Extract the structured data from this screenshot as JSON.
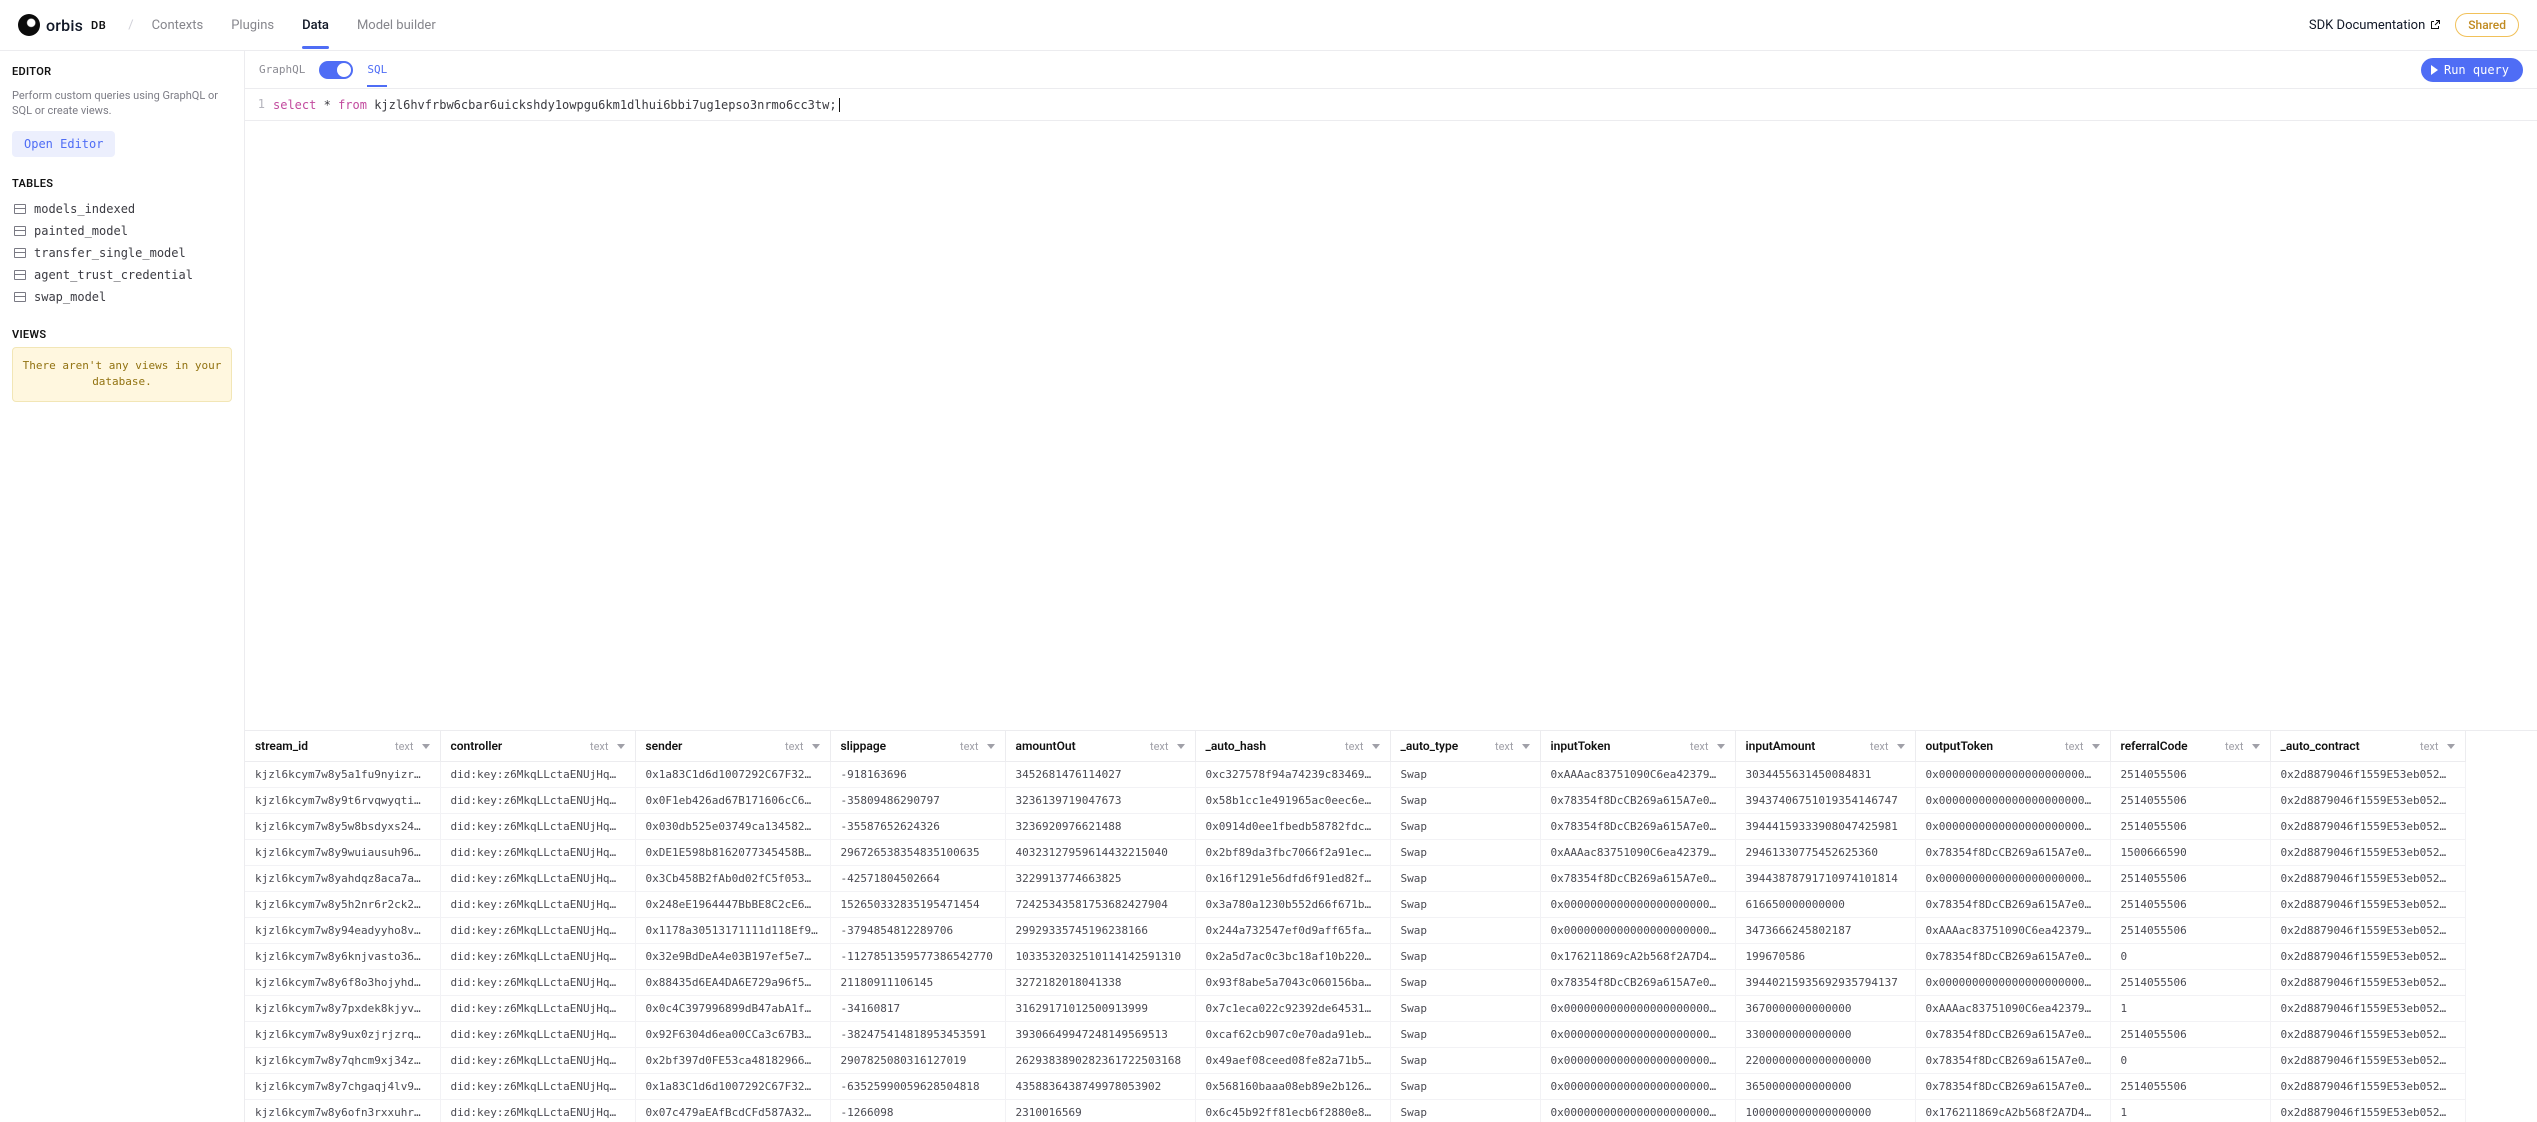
{
  "topbar": {
    "logo_text": "orbis",
    "logo_suffix": "DB",
    "nav": {
      "contexts": "Contexts",
      "plugins": "Plugins",
      "data": "Data",
      "model_builder": "Model builder"
    },
    "sdk_doc": "SDK Documentation",
    "shared": "Shared"
  },
  "sidebar": {
    "editor_title": "EDITOR",
    "editor_desc": "Perform custom queries using GraphQL or SQL or create views.",
    "open_editor": "Open Editor",
    "tables_title": "TABLES",
    "tables": [
      "models_indexed",
      "painted_model",
      "transfer_single_model",
      "agent_trust_credential",
      "swap_model"
    ],
    "views_title": "VIEWS",
    "views_empty": "There aren't any views in your database."
  },
  "editor": {
    "mode_graphql": "GraphQL",
    "mode_sql": "SQL",
    "run": "Run query",
    "line_no": "1",
    "kw_select": "select",
    "kw_from": "from",
    "star": "*",
    "table_ref": "kjzl6hvfrbw6cbar6uickshdy1owpgu6km1dlhui6bbi7ug1epso3nrmo6cc3tw;"
  },
  "columns": [
    {
      "name": "stream_id",
      "type": "text"
    },
    {
      "name": "controller",
      "type": "text"
    },
    {
      "name": "sender",
      "type": "text"
    },
    {
      "name": "slippage",
      "type": "text"
    },
    {
      "name": "amountOut",
      "type": "text"
    },
    {
      "name": "_auto_hash",
      "type": "text"
    },
    {
      "name": "_auto_type",
      "type": "text"
    },
    {
      "name": "inputToken",
      "type": "text"
    },
    {
      "name": "inputAmount",
      "type": "text"
    },
    {
      "name": "outputToken",
      "type": "text"
    },
    {
      "name": "referralCode",
      "type": "text"
    },
    {
      "name": "_auto_contract",
      "type": "text"
    }
  ],
  "rows": [
    [
      "kjzl6kcym7w8y5a1fu9nyizr…",
      "did:key:z6MkqLLctaENUjHq…",
      "0x1a83C1d6d1007292C67F32…",
      "-918163696",
      "3452681476114027",
      "0xc327578f94a74239c83469…",
      "Swap",
      "0xAAAac83751090C6ea42379…",
      "3034455631450084831",
      "0x0000000000000000000000…",
      "2514055506",
      "0x2d8879046f1559E53eb052…"
    ],
    [
      "kjzl6kcym7w8y9t6rvqwyqti…",
      "did:key:z6MkqLLctaENUjHq…",
      "0x0F1eb426ad67B171606cC6…",
      "-35809486290797",
      "3236139719047673",
      "0x58b1cc1e491965ac0eec6e…",
      "Swap",
      "0x78354f8DcCB269a615A7e0…",
      "39437406751019354146747",
      "0x0000000000000000000000…",
      "2514055506",
      "0x2d8879046f1559E53eb052…"
    ],
    [
      "kjzl6kcym7w8y5w8bsdyxs24…",
      "did:key:z6MkqLLctaENUjHq…",
      "0x030db525e03749ca134582…",
      "-3558765262432­6",
      "3236920976621488",
      "0x0914d0ee1fbedb58782fdc…",
      "Swap",
      "0x78354f8DcCB269a615A7e0…",
      "39444159333908047425981",
      "0x0000000000000000000000…",
      "2514055506",
      "0x2d8879046f1559E53eb052…"
    ],
    [
      "kjzl6kcym7w8y9wuiausuh96…",
      "did:key:z6MkqLLctaENUjHq…",
      "0xDE1E598b8162077345458B…",
      "296726538354835100635",
      "403231279596144322150­40",
      "0x2bf89da3fbc7066f2a91ec…",
      "Swap",
      "0xAAAac83751090C6ea42379…",
      "29461330775452625360",
      "0x78354f8DcCB269a615A7e0…",
      "1500666590",
      "0x2d8879046f1559E53eb052…"
    ],
    [
      "kjzl6kcym7w8yahdqz8aca7a…",
      "did:key:z6MkqLLctaENUjHq…",
      "0x3Cb458B2fAb0d02fC5f053…",
      "-42571804502664",
      "3229913774663825",
      "0x16f1291e56dfd6f91ed82f…",
      "Swap",
      "0x78354f8DcCB269a615A7e0…",
      "39443878791710974101814",
      "0x0000000000000000000000…",
      "2514055506",
      "0x2d8879046f1559E53eb052…"
    ],
    [
      "kjzl6kcym7w8y5h2nr6r2ck2…",
      "did:key:z6MkqLLctaENUjHq…",
      "0x248eE1964447BbBE8C2cE6…",
      "1526503328351954714­54",
      "72425343581753682427904",
      "0x3a780a1230b552d66f671b…",
      "Swap",
      "0x0000000000000000000000…",
      "616650000000000",
      "0x78354f8DcCB269a615A7e0…",
      "2514055506",
      "0x2d8879046f1559E53eb052…"
    ],
    [
      "kjzl6kcym7w8y94eadyyho8v…",
      "did:key:z6MkqLLctaENUjHq…",
      "0x1178a30513171111d118Ef9…",
      "-379485481228970­6",
      "29929335745196238166",
      "0x244a732547ef0d9aff65fa…",
      "Swap",
      "0x0000000000000000000000…",
      "3473666245802187",
      "0xAAAac83751090C6ea42379…",
      "2514055506",
      "0x2d8879046f1559E53eb052…"
    ],
    [
      "kjzl6kcym7w8y6knjvasto36…",
      "did:key:z6MkqLLctaENUjHq…",
      "0x32e9BdDeA4e03B197ef5e7…",
      "-11278­513595773865427­70",
      "10335320325101141425913­10",
      "0x2a5d7ac0c3bc18af10b220…",
      "Swap",
      "0x176211869cA2b568f2A7D4…",
      "199670586",
      "0x78354f8DcCB269a615A7e0…",
      "0",
      "0x2d8879046f1559E53eb052…"
    ],
    [
      "kjzl6kcym7w8y6f8o3hojyhd…",
      "did:key:z6MkqLLctaENUjHq…",
      "0x88435d6EA4DA6E729a96f5…",
      "21180911106145",
      "3272182018041338",
      "0x93f8abe5a7043c060156ba…",
      "Swap",
      "0x78354f8DcCB269a615A7e0…",
      "39440215935692935794137",
      "0x0000000000000000000000…",
      "2514055506",
      "0x2d8879046f1559E53eb052…"
    ],
    [
      "kjzl6kcym7w8y7pxdek8kjyv…",
      "did:key:z6MkqLLctaENUjHq…",
      "0x0c4C397996­899dB47abA1f…",
      "-34160817",
      "31629171012500913999",
      "0x7c1eca022c92392de64531…",
      "Swap",
      "0x0000000000000000000000…",
      "3670000000000000",
      "0xAAAac83751090C6ea42379…",
      "1",
      "0x2d8879046f1559E53eb052…"
    ],
    [
      "kjzl6kcym7w8y9ux0zjrjzrq…",
      "did:key:z6MkqLLctaENUjHq…",
      "0x92F6304d6ea00CCa3c67B3…",
      "-382475414818953453591",
      "3930664994724814956951­3",
      "0xcaf62cb907c0e70ada91eb…",
      "Swap",
      "0x0000000000000000000000…",
      "3300000000000000",
      "0x78354f8DcCB269a615A7e0…",
      "2514055506",
      "0x2d8879046f1559E53eb052…"
    ],
    [
      "kjzl6kcym7w8y7qhcm9xj34z…",
      "did:key:z6MkqLLctaENUjHq…",
      "0x2bf397d0FE53ca48182966…",
      "290782508031612701­9",
      "2629383890282361722503168",
      "0x49aef08cee­d08fe82a71b5…",
      "Swap",
      "0x0000000000000000000000…",
      "2200000000000000000",
      "0x78354f8DcCB269a615A7e0…",
      "0",
      "0x2d8879046f1559E53eb052…"
    ],
    [
      "kjzl6kcym7w8y7chgaqj4lv9…",
      "did:key:z6MkqLLctaENUjHq…",
      "0x1a83C1d6d1007292C67F32…",
      "-63525990059628504818",
      "43588364387499780539­02",
      "0x568160baaa08eb89e2b126…",
      "Swap",
      "0x0000000000000000000000…",
      "3650000000000000",
      "0x78354f8DcCB269a615A7e0…",
      "2514055506",
      "0x2d8879046f1559E53eb052…"
    ],
    [
      "kjzl6kcym7w8y6ofn3rxxuhr…",
      "did:key:z6MkqLLctaENUjHq…",
      "0x07c479aEAfBcdCFd587A32…",
      "-1266098",
      "2310016569",
      "0x6c45b92ff81ecb6f2880e8…",
      "Swap",
      "0x0000000000000000000000…",
      "1000000000000000000",
      "0x176211869cA2b568f2A7D4…",
      "1",
      "0x2d8879046f1559E53eb052…"
    ]
  ]
}
